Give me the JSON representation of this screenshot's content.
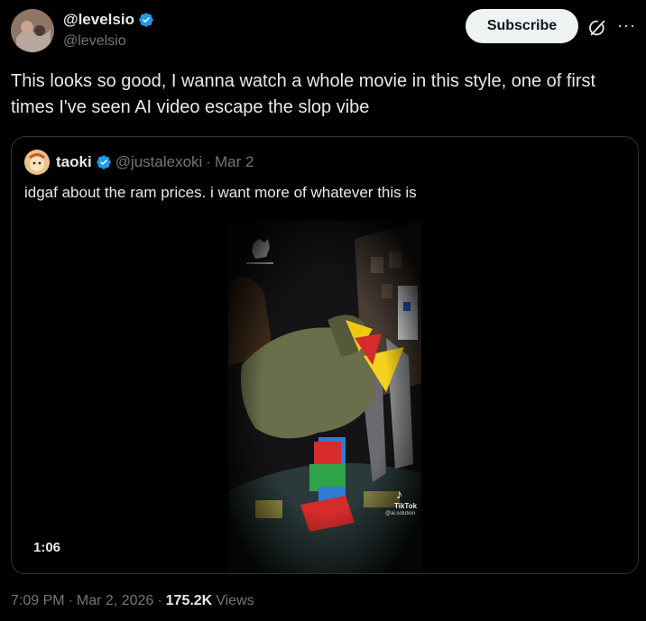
{
  "author": {
    "display_name": "@levelsio",
    "handle": "@levelsio"
  },
  "actions": {
    "subscribe_label": "Subscribe",
    "more_icon": "more-horizontal-icon",
    "grok_icon": "grok-icon"
  },
  "tweet": {
    "text": "This looks so good, I wanna watch a whole movie in this style, one of first times I've seen AI video escape the slop vibe"
  },
  "quote": {
    "display_name": "taoki",
    "handle": "@justalexoki",
    "separator": "·",
    "date": "Mar 2",
    "text": "idgaf about the ram prices. i want more of whatever this is",
    "video": {
      "duration": "1:06",
      "watermark_app": "TikTok",
      "watermark_user": "@ai.solution"
    }
  },
  "meta": {
    "time": "7:09 PM",
    "sep1": "·",
    "date": "Mar 2, 2026",
    "sep2": "·",
    "views_count": "175.2K",
    "views_label": "Views"
  },
  "colors": {
    "background": "#000000",
    "text": "#e7e9ea",
    "secondary": "#71767b",
    "verified": "#1d9bf0",
    "border": "#2f3336"
  }
}
